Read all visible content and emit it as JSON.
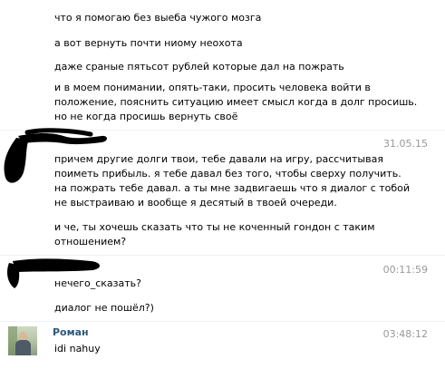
{
  "group1": {
    "lines": [
      "что я помогаю без выеба чужого мозга",
      "а вот вернуть почти ниому неохота",
      "даже сраные пятьсот рублей которые дал на пожрать",
      "и в моем понимании, опять-таки, просить человека войти в",
      "положение, пояснить ситуацию имеет смысл когда в долг просишь.",
      "но не когда просишь вернуть своё"
    ]
  },
  "group2": {
    "timestamp": "31.05.15",
    "lines": [
      "причем другие долги твои, тебе давали на игру, рассчитывая",
      "поиметь прибыль. я тебе давал без того, чтобы сверху получить.",
      "на пожрать тебе давал. а ты мне задвигаешь что я диалог с тобой",
      "не выстраиваю и вообще я десятый в твоей очереди.",
      "и че, ты хочешь сказать что ты не коченный гондон с таким",
      "отношением?"
    ]
  },
  "group3": {
    "timestamp": "00:11:59",
    "lines": [
      "нечего_сказать?",
      "диалог не пошёл?)"
    ]
  },
  "group4": {
    "author": "Роман",
    "timestamp": "03:48:12",
    "lines": [
      "idi nahuy"
    ]
  },
  "colors": {
    "author_link": "#2b587a",
    "timestamp": "#999999",
    "censor_ink": "#000000"
  }
}
